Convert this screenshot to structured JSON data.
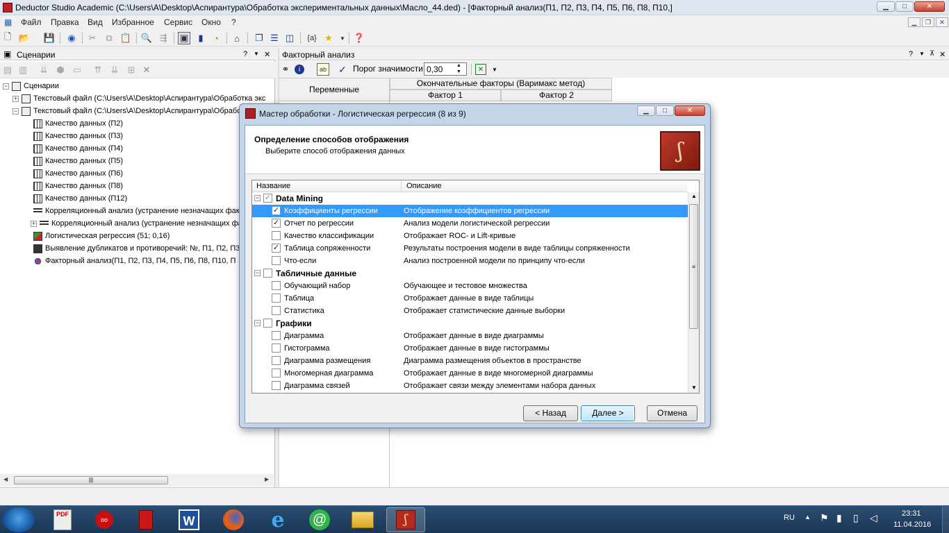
{
  "window": {
    "title": "Deductor Studio Academic (C:\\Users\\A\\Desktop\\Аспирантура\\Обработка экспериментальных данных\\Масло_44.ded) - [Факторный анализ(П1, П2, П3, П4, П5, П6, П8, П10,]"
  },
  "menu": [
    "Файл",
    "Правка",
    "Вид",
    "Избранное",
    "Сервис",
    "Окно",
    "?"
  ],
  "left_pane": {
    "title": "Сценарии",
    "tree": [
      {
        "label": "Сценарии",
        "level": 0,
        "expander": "−",
        "icon": "scenarios-icon"
      },
      {
        "label": "Текстовый файл (C:\\Users\\A\\Desktop\\Аспирантура\\Обработка экс",
        "level": 1,
        "expander": "+",
        "icon": "text-file-icon"
      },
      {
        "label": "Текстовый файл (C:\\Users\\A\\Desktop\\Аспирантура\\Обработ",
        "level": 1,
        "expander": "−",
        "icon": "text-file-icon"
      },
      {
        "label": "Качество данных (П2)",
        "level": 2,
        "expander": "",
        "icon": "data-quality-icon"
      },
      {
        "label": "Качество данных (П3)",
        "level": 2,
        "expander": "",
        "icon": "data-quality-icon"
      },
      {
        "label": "Качество данных (П4)",
        "level": 2,
        "expander": "",
        "icon": "data-quality-icon"
      },
      {
        "label": "Качество данных (П5)",
        "level": 2,
        "expander": "",
        "icon": "data-quality-icon"
      },
      {
        "label": "Качество данных (П6)",
        "level": 2,
        "expander": "",
        "icon": "data-quality-icon"
      },
      {
        "label": "Качество данных (П8)",
        "level": 2,
        "expander": "",
        "icon": "data-quality-icon"
      },
      {
        "label": "Качество данных (П12)",
        "level": 2,
        "expander": "",
        "icon": "data-quality-icon"
      },
      {
        "label": "Корреляционный анализ (устранение незначащих фак",
        "level": 2,
        "expander": "",
        "icon": "correlation-icon"
      },
      {
        "label": "Корреляционный анализ (устранение незначащих фак",
        "level": 2,
        "expander": "+",
        "icon": "correlation-icon"
      },
      {
        "label": "Логистическая регрессия (51; 0,16)",
        "level": 2,
        "expander": "",
        "icon": "logistic-regression-icon"
      },
      {
        "label": "Выявление дубликатов и противоречий: №, П1, П2, П3",
        "level": 2,
        "expander": "",
        "icon": "duplicates-icon"
      },
      {
        "label": "Факторный анализ(П1, П2, П3, П4, П5, П6, П8, П10, П",
        "level": 2,
        "expander": "",
        "icon": "factor-analysis-icon"
      }
    ]
  },
  "right_pane": {
    "title": "Факторный анализ",
    "threshold_label": "Порог значимости",
    "threshold_value": "0,30",
    "grid": {
      "col_variables": "Переменные",
      "group_header": "Окончательные факторы (Варимакс метод)",
      "factor1": "Фактор 1",
      "factor2": "Фактор 2"
    }
  },
  "dialog": {
    "title": "Мастер обработки - Логистическая регрессия (8 из 9)",
    "heading": "Определение способов отображения",
    "subheading": "Выберите способ отображения данных",
    "columns": {
      "name": "Название",
      "description": "Описание"
    },
    "rows": [
      {
        "type": "group",
        "name": "Data Mining",
        "checked": "✓",
        "checkbox_grey": true
      },
      {
        "type": "item",
        "name": "Коэффициенты регрессии",
        "description": "Отображение коэффициентов регрессии",
        "checked": "✓",
        "selected": true
      },
      {
        "type": "item",
        "name": "Отчет по регрессии",
        "description": "Анализ модели логистической регрессии",
        "checked": "✓"
      },
      {
        "type": "item",
        "name": "Качество классификации",
        "description": "Отображает ROC- и Lift-кривые",
        "checked": ""
      },
      {
        "type": "item",
        "name": "Таблица сопряженности",
        "description": "Результаты построения модели в виде таблицы сопряженности",
        "checked": "✓"
      },
      {
        "type": "item",
        "name": "Что-если",
        "description": "Анализ построенной модели по принципу что-если",
        "checked": ""
      },
      {
        "type": "group",
        "name": "Табличные данные",
        "checked": ""
      },
      {
        "type": "item",
        "name": "Обучающий набор",
        "description": "Обучающее и тестовое множества",
        "checked": ""
      },
      {
        "type": "item",
        "name": "Таблица",
        "description": "Отображает данные в виде таблицы",
        "checked": ""
      },
      {
        "type": "item",
        "name": "Статистика",
        "description": "Отображает статистические данные выборки",
        "checked": ""
      },
      {
        "type": "group",
        "name": "Графики",
        "checked": ""
      },
      {
        "type": "item",
        "name": "Диаграмма",
        "description": "Отображает данные в виде диаграммы",
        "checked": ""
      },
      {
        "type": "item",
        "name": "Гистограмма",
        "description": "Отображает данные в виде гистограммы",
        "checked": ""
      },
      {
        "type": "item",
        "name": "Диаграмма размещения",
        "description": "Диаграмма размещения объектов в пространстве",
        "checked": ""
      },
      {
        "type": "item",
        "name": "Многомерная диаграмма",
        "description": "Отображает данные в виде многомерной диаграммы",
        "checked": ""
      },
      {
        "type": "item",
        "name": "Диаграмма связей",
        "description": "Отображает связи между элементами набора данных",
        "checked": ""
      }
    ],
    "buttons": {
      "back": "< Назад",
      "next": "Далее >",
      "cancel": "Отмена"
    }
  },
  "taskbar": {
    "lang": "RU",
    "time": "23:31",
    "date": "11.04.2016",
    "apps": [
      "pdf-app-icon",
      "app-red-icon",
      "book-icon",
      "word-icon",
      "firefox-icon",
      "ie-icon",
      "mail-agent-icon",
      "explorer-icon",
      "deductor-icon"
    ]
  },
  "colors": {
    "selection": "#3399ff",
    "dialog_frame": "#c4d5ea",
    "taskbar": "#1b3654"
  }
}
